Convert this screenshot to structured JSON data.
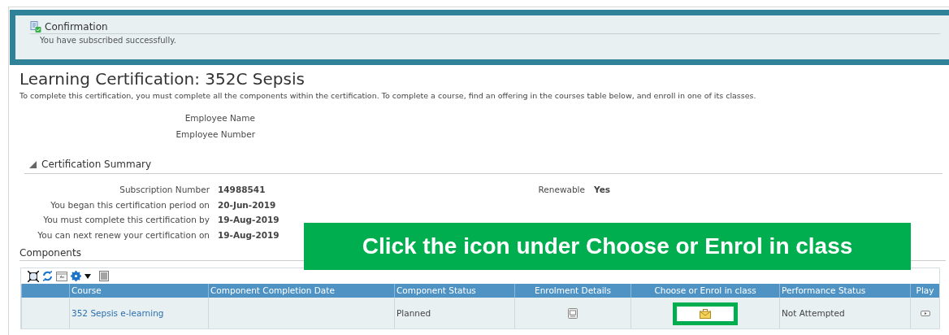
{
  "confirmation": {
    "title": "Confirmation",
    "message": "You have subscribed successfully."
  },
  "page_title": "Learning Certification: 352C Sepsis",
  "instructions": "To complete this certification, you must complete all the components within the certification. To complete a course, find an offering in the courses table below, and enroll in one of its classes.",
  "employee_fields": [
    {
      "label": "Employee Name"
    },
    {
      "label": "Employee Number"
    }
  ],
  "summary": {
    "title": "Certification Summary",
    "expanded": true,
    "fields": [
      {
        "label": "Subscription Number",
        "value": "14988541"
      },
      {
        "label": "You began this certification period on",
        "value": "20-Jun-2019"
      },
      {
        "label": "You must complete this certification by",
        "value": "19-Aug-2019"
      },
      {
        "label": "You can next renew your certification on",
        "value": "19-Aug-2019"
      }
    ],
    "side_fields": [
      {
        "label": "Renewable",
        "value": "Yes"
      }
    ]
  },
  "components": {
    "title": "Components",
    "columns": [
      "Course",
      "Component Completion Date",
      "Component Status",
      "Enrolment Details",
      "Choose or Enrol in class",
      "Performance Status",
      "Play"
    ],
    "rows": [
      {
        "course": "352 Sepsis e-learning",
        "status": "Planned",
        "performance_status": "Not Attempted",
        "highlighted": true
      }
    ]
  },
  "callout": {
    "text": "Click the icon under Choose or Enrol in class"
  }
}
